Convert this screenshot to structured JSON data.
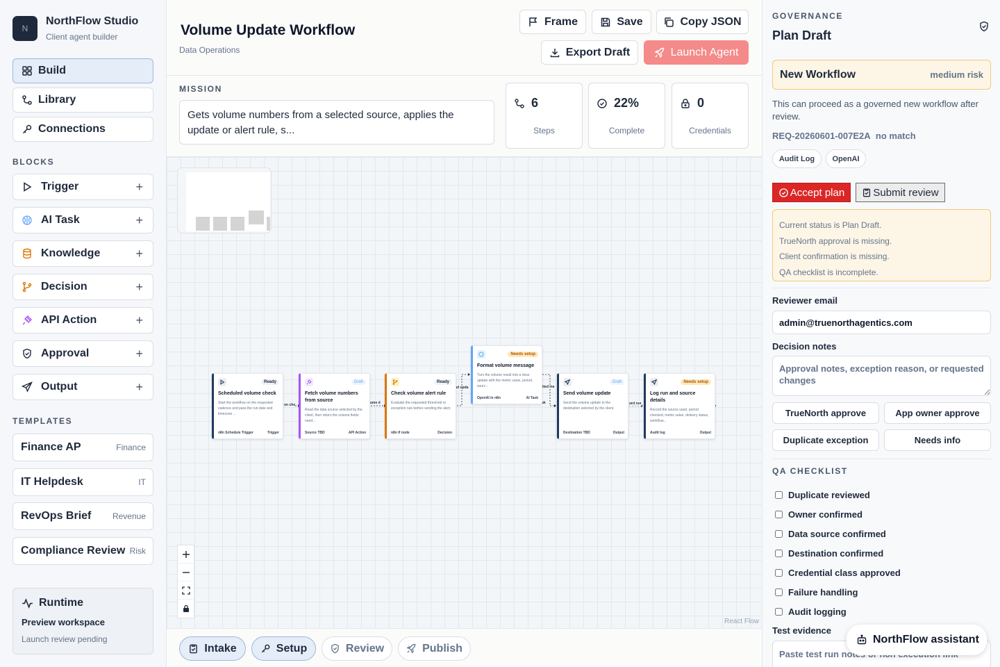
{
  "brand": {
    "logo_letter": "N",
    "name": "NorthFlow Studio",
    "subtitle": "Client agent builder"
  },
  "nav": [
    {
      "label": "Build",
      "icon": "grid-icon",
      "active": true
    },
    {
      "label": "Library",
      "icon": "library-icon",
      "active": false
    },
    {
      "label": "Connections",
      "icon": "key-icon",
      "active": false
    }
  ],
  "blocks": {
    "heading": "BLOCKS",
    "items": [
      {
        "label": "Trigger",
        "icon": "play-icon",
        "color": "#1e293b"
      },
      {
        "label": "AI Task",
        "icon": "brain-icon",
        "color": "#60a5fa"
      },
      {
        "label": "Knowledge",
        "icon": "database-icon",
        "color": "#d97706"
      },
      {
        "label": "Decision",
        "icon": "branch-icon",
        "color": "#d97706"
      },
      {
        "label": "API Action",
        "icon": "plug-icon",
        "color": "#a855f7"
      },
      {
        "label": "Approval",
        "icon": "shield-icon",
        "color": "#1e293b"
      },
      {
        "label": "Output",
        "icon": "send-icon",
        "color": "#1e293b"
      }
    ]
  },
  "templates": {
    "heading": "TEMPLATES",
    "items": [
      {
        "name": "Finance AP",
        "tag": "Finance"
      },
      {
        "name": "IT Helpdesk",
        "tag": "IT"
      },
      {
        "name": "RevOps Brief",
        "tag": "Revenue"
      },
      {
        "name": "Compliance Review",
        "tag": "Risk"
      }
    ]
  },
  "runtime": {
    "title": "Runtime",
    "workspace": "Preview workspace",
    "status": "Launch review pending"
  },
  "header": {
    "title": "Volume Update Workflow",
    "subtitle": "Data Operations",
    "buttons": {
      "frame": "Frame",
      "save": "Save",
      "copy_json": "Copy JSON",
      "export": "Export Draft",
      "launch": "Launch Agent"
    }
  },
  "mission": {
    "label": "MISSION",
    "text": "Gets volume numbers from a selected source, applies the update or alert rule, s..."
  },
  "stats": [
    {
      "value": "6",
      "label": "Steps",
      "icon": "steps-icon"
    },
    {
      "value": "22%",
      "label": "Complete",
      "icon": "check-circle-icon"
    },
    {
      "value": "0",
      "label": "Credentials",
      "icon": "lock-icon"
    }
  ],
  "canvas": {
    "attribution": "React Flow",
    "nodes": [
      {
        "title": "Scheduled volume check",
        "badge": "Ready",
        "badge_type": "ready",
        "icon": "play-icon",
        "desc": "Start the workflow on the requested cadence and pass the run date and timezone ...",
        "foot_left": "n8n Schedule Trigger",
        "foot_right": "Trigger",
        "accent": "#1e3a5f"
      },
      {
        "title": "Fetch volume numbers from source",
        "badge": "Draft",
        "badge_type": "draft",
        "icon": "plug-icon",
        "desc": "Read the data source selected by the client, then return the volume fields need...",
        "foot_left": "Source TBD",
        "foot_right": "API Action",
        "accent": "#a855f7"
      },
      {
        "title": "Check volume alert rule",
        "badge": "Ready",
        "badge_type": "ready",
        "icon": "branch-icon",
        "desc": "Evaluate the requested threshold or exception rule before sending the alert.",
        "foot_left": "n8n If node",
        "foot_right": "Decision",
        "accent": "#d97706"
      },
      {
        "title": "Format volume message",
        "badge": "Needs setup",
        "badge_type": "setup",
        "icon": "brain-icon",
        "desc": "Turn the volume result into a clear update with the metric value, period, sourc...",
        "foot_left": "OpenAI in n8n",
        "foot_right": "AI Task",
        "accent": "#60a5fa"
      },
      {
        "title": "Send volume update",
        "badge": "Draft",
        "badge_type": "draft",
        "icon": "send-icon",
        "desc": "Send the volume update to the destination selected by the client.",
        "foot_left": "Destination TBD",
        "foot_right": "Output",
        "accent": "#1e3a5f"
      },
      {
        "title": "Log run and source details",
        "badge": "Needs setup",
        "badge_type": "setup",
        "icon": "send-icon",
        "desc": "Record the source used, period checked, metric value, delivery status, workflow...",
        "foot_left": "Audit log",
        "foot_right": "Output",
        "accent": "#1e3a5f"
      }
    ],
    "edge_labels": [
      "on che",
      "ume d",
      "nd upda",
      "ited me",
      "ent or sk",
      "ord run"
    ]
  },
  "steps": [
    {
      "label": "Intake",
      "icon": "clipboard-icon",
      "state": "done"
    },
    {
      "label": "Setup",
      "icon": "key-icon",
      "state": "done"
    },
    {
      "label": "Review",
      "icon": "shield-icon",
      "state": "off"
    },
    {
      "label": "Publish",
      "icon": "rocket-icon",
      "state": "off"
    }
  ],
  "governance": {
    "label": "GOVERNANCE",
    "title": "Plan Draft",
    "workflow_name": "New Workflow",
    "risk": "medium risk",
    "description": "This can proceed as a governed new workflow after review.",
    "request_id": "REQ-20260601-007E2A",
    "match": "no match",
    "pills": [
      "Audit Log",
      "OpenAI"
    ],
    "accept_label": "Accept plan",
    "submit_label": "Submit review",
    "status_lines": [
      "Current status is Plan Draft.",
      "TrueNorth approval is missing.",
      "Client confirmation is missing.",
      "QA checklist is incomplete."
    ],
    "reviewer_email_label": "Reviewer email",
    "reviewer_email": "admin@truenorthagentics.com",
    "notes_label": "Decision notes",
    "notes_placeholder": "Approval notes, exception reason, or requested changes",
    "actions": [
      "TrueNorth approve",
      "App owner approve",
      "Duplicate exception",
      "Needs info"
    ],
    "qa_label": "QA CHECKLIST",
    "qa_items": [
      "Duplicate reviewed",
      "Owner confirmed",
      "Data source confirmed",
      "Destination confirmed",
      "Credential class approved",
      "Failure handling",
      "Audit logging"
    ],
    "evidence_label": "Test evidence",
    "evidence_placeholder": "Paste test run notes or n8n execution link"
  },
  "assistant": {
    "label": "NorthFlow assistant"
  },
  "colors": {
    "accent": "#e4edf8",
    "launch": "#f58a8a",
    "warning_bg": "#fdf6e6",
    "warning_border": "#f3c879",
    "accept": "#dc2626"
  }
}
